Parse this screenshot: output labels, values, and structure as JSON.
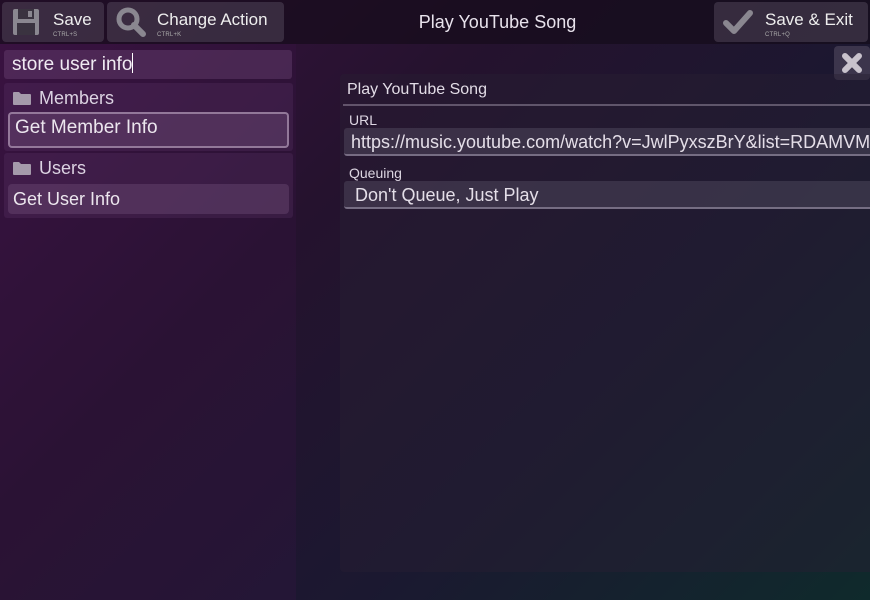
{
  "toolbar": {
    "save_label": "Save",
    "save_shortcut": "CTRL+S",
    "change_label": "Change Action",
    "change_shortcut": "CTRL+K",
    "exit_label": "Save & Exit",
    "exit_shortcut": "CTRL+Q"
  },
  "window": {
    "title": "Play YouTube Song"
  },
  "search": {
    "value": "store user info"
  },
  "groups": [
    {
      "label": "Members",
      "icon": "folder-icon",
      "items": [
        {
          "label": "Get Member Info",
          "selected": true
        }
      ]
    },
    {
      "label": "Users",
      "icon": "folder-icon",
      "items": [
        {
          "label": "Get User Info",
          "selected": false
        }
      ]
    }
  ],
  "panel": {
    "title": "Play YouTube Song",
    "url_label": "URL",
    "url_value": "https://music.youtube.com/watch?v=JwlPyxszBrY&list=RDAMVM",
    "queue_label": "Queuing",
    "queue_value": "Don't Queue, Just Play"
  },
  "colors": {
    "background_start": "#3a1240",
    "background_end": "#0f2a2c",
    "accent": "#cfc4d6"
  },
  "icons": [
    "floppy-disk-icon",
    "magnifier-icon",
    "checkmark-icon",
    "folder-icon",
    "close-icon"
  ]
}
